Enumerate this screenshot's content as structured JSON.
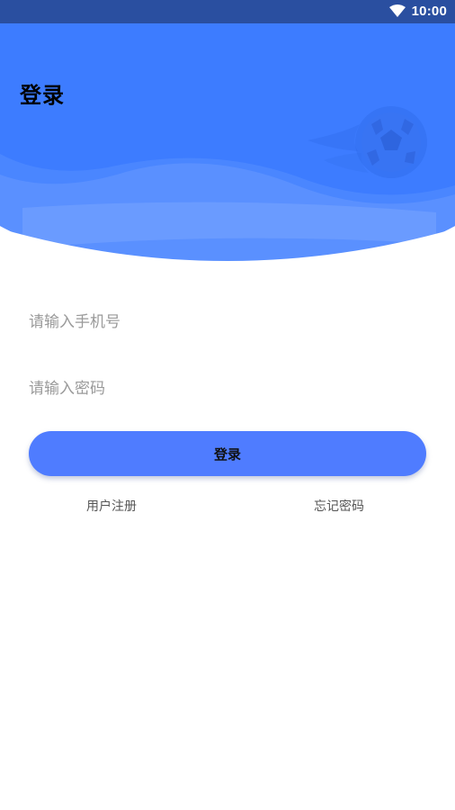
{
  "status_bar": {
    "time": "10:00",
    "wifi_icon": "wifi-icon"
  },
  "header": {
    "title": "登录",
    "illustration_icon": "soccer-ball-icon"
  },
  "form": {
    "phone_placeholder": "请输入手机号",
    "password_placeholder": "请输入密码",
    "login_label": "登录"
  },
  "links": {
    "register": "用户注册",
    "forgot_password": "忘记密码"
  },
  "colors": {
    "status_bar": "#2a4fa0",
    "header_blue": "#3d7cff",
    "button": "#4f7cff"
  }
}
